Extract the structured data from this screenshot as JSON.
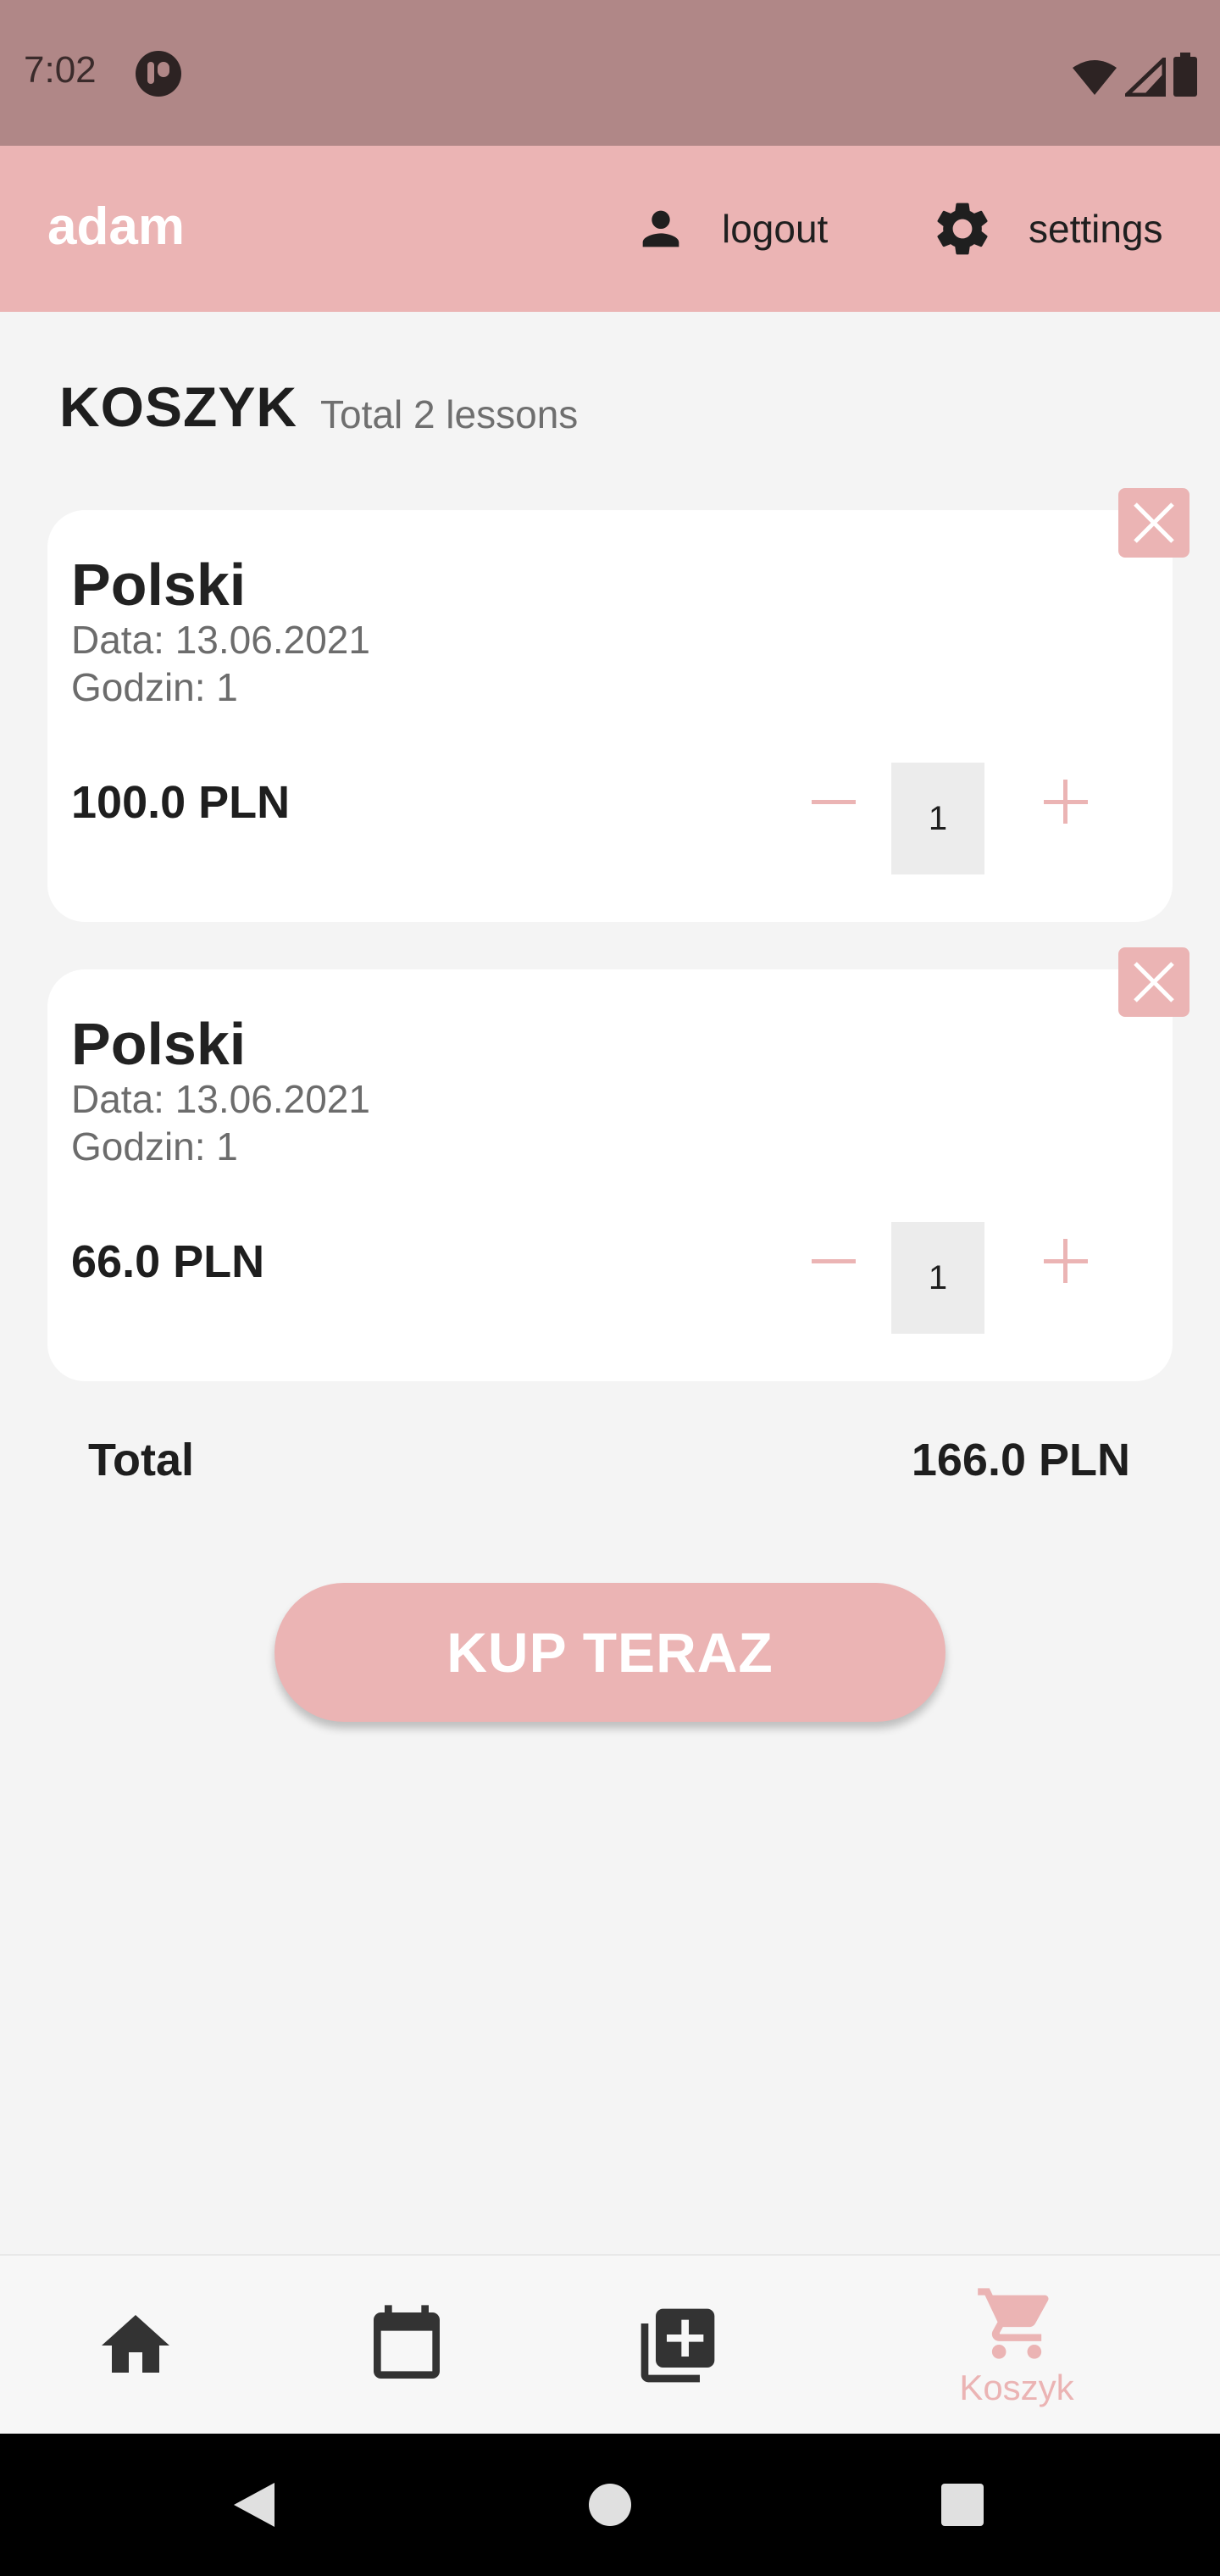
{
  "status_bar": {
    "time": "7:02",
    "icons": [
      "app-notification-icon",
      "wifi-icon",
      "signal-icon",
      "battery-icon"
    ]
  },
  "app_bar": {
    "username": "adam",
    "logout_label": "logout",
    "settings_label": "settings",
    "background": "#ebb4b4"
  },
  "cart": {
    "title": "KOSZYK",
    "subtitle": "Total 2 lessons",
    "items": [
      {
        "title": "Polski",
        "date": "Data: 13.06.2021",
        "hours": "Godzin: 1",
        "price": "100.0 PLN",
        "quantity": "1"
      },
      {
        "title": "Polski",
        "date": "Data: 13.06.2021",
        "hours": "Godzin: 1",
        "price": "66.0 PLN",
        "quantity": "1"
      }
    ],
    "total_label": "Total",
    "total_value": "166.0 PLN",
    "buy_label": "KUP TERAZ"
  },
  "bottom_nav": {
    "items": [
      {
        "icon": "home-icon",
        "label": ""
      },
      {
        "icon": "calendar-icon",
        "label": ""
      },
      {
        "icon": "add-library-icon",
        "label": ""
      },
      {
        "icon": "cart-icon",
        "label": "Koszyk",
        "active": true
      }
    ],
    "active_color": "#ebb4b4",
    "inactive_color": "#333333"
  },
  "colors": {
    "accent": "#ebb4b4",
    "status_bar": "#b08787",
    "page_background": "#f4f4f4"
  }
}
